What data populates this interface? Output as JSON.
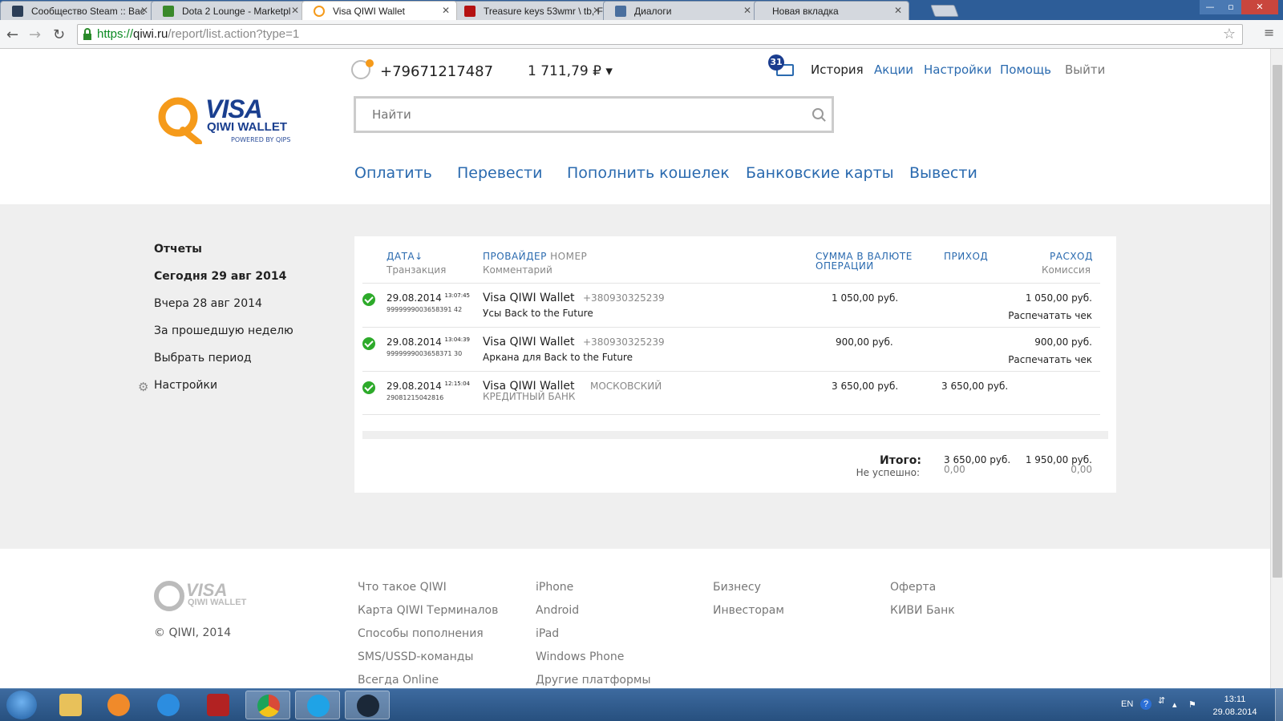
{
  "browser": {
    "tabs": [
      {
        "title": "Сообщество Steam :: Вас",
        "active": false,
        "fav_color": "#2c3e57"
      },
      {
        "title": "Dota 2 Lounge - Marketpl",
        "active": false,
        "fav_color": "#3b8a2b"
      },
      {
        "title": "Visa QIWI Wallet",
        "active": true,
        "fav_color": "#f59a1a"
      },
      {
        "title": "Treasure keys 53wmr \\ tb, F",
        "active": false,
        "fav_color": "#b51212"
      },
      {
        "title": "Диалоги",
        "active": false,
        "fav_color": "#4a6f9e"
      },
      {
        "title": "Новая вкладка",
        "active": false,
        "fav_color": ""
      }
    ],
    "url_scheme": "https://",
    "url_domain": "qiwi.ru",
    "url_path": "/report/list.action?type=1",
    "window_buttons": {
      "minimize": "—",
      "maximize": "▫",
      "close": "✕"
    }
  },
  "header": {
    "logo": {
      "visa": "VISA",
      "wallet": "QIWI WALLET",
      "powered": "POWERED BY QIPS"
    },
    "phone": "+79671217487",
    "balance": "1 711,79 ₽ ▾",
    "mail_count": "31",
    "top_nav": [
      {
        "label": "История",
        "active": true
      },
      {
        "label": "Акции",
        "active": false
      },
      {
        "label": "Настройки",
        "active": false
      },
      {
        "label": "Помощь",
        "active": false
      },
      {
        "label": "Выйти",
        "active": false
      }
    ],
    "search_placeholder": "Найти",
    "main_nav": [
      "Оплатить",
      "Перевести",
      "Пополнить кошелек",
      "Банковские карты",
      "Вывести"
    ]
  },
  "sidebar": {
    "items": [
      "Отчеты",
      "Сегодня 29 авг 2014",
      "Вчера 28 авг 2014",
      "За прошедшую неделю",
      "Выбрать период",
      "Настройки"
    ]
  },
  "table": {
    "headers": {
      "date": "ДАТА",
      "date_sort": "↓",
      "date_sub": "Транзакция",
      "provider": "ПРОВАЙДЕР",
      "number": "НОМЕР",
      "provider_sub": "Комментарий",
      "amount_l1": "СУММА В ВАЛЮТЕ",
      "amount_l2": "ОПЕРАЦИИ",
      "income": "ПРИХОД",
      "expense": "РАСХОД",
      "expense_sub": "Комиссия"
    },
    "rows": [
      {
        "date": "29.08.2014",
        "time": "13:07:45",
        "txn": "9999999003658391 42",
        "provider": "Visa QIWI Wallet",
        "number": "+380930325239",
        "comment": "Усы Back to the Future",
        "amount": "1 050,00 руб.",
        "income": "",
        "expense": "1 050,00 руб.",
        "action": "Распечатать чек"
      },
      {
        "date": "29.08.2014",
        "time": "13:04:39",
        "txn": "9999999003658371 30",
        "provider": "Visa QIWI Wallet",
        "number": "+380930325239",
        "comment": "Аркана для Back to the Future",
        "amount": "900,00 руб.",
        "income": "",
        "expense": "900,00 руб.",
        "action": "Распечатать чек"
      },
      {
        "date": "29.08.2014",
        "time": "12:15:04",
        "txn": "29081215042816",
        "provider": "Visa QIWI Wallet",
        "number": "МОСКОВСКИЙ",
        "comment": "КРЕДИТНЫЙ БАНК",
        "amount": "3 650,00 руб.",
        "income": "3 650,00 руб.",
        "expense": "",
        "action": ""
      }
    ],
    "totals": {
      "label": "Итого:",
      "failed_label": "Не успешно:",
      "income": "3 650,00 руб.",
      "income_failed": "0,00",
      "expense": "1 950,00 руб.",
      "expense_failed": "0,00"
    }
  },
  "footer": {
    "logo": {
      "visa": "VISA",
      "wallet": "QIWI WALLET"
    },
    "copyright": "© QIWI, 2014",
    "col1": [
      "Что такое QIWI",
      "Карта QIWI Терминалов",
      "Способы пополнения",
      "SMS/USSD-команды",
      "Всегда Online"
    ],
    "col2": [
      "iPhone",
      "Android",
      "iPad",
      "Windows Phone",
      "Другие платформы"
    ],
    "col3": [
      "Бизнесу",
      "Инвесторам"
    ],
    "col4": [
      "Оферта",
      "КИВИ Банк"
    ]
  },
  "taskbar": {
    "apps": [
      "Проводник",
      "Media Player",
      "Internet Explorer",
      "Dota 2",
      "Google Chrome",
      "Skype",
      "Steam"
    ],
    "lang": "EN",
    "time": "13:11",
    "date": "29.08.2014"
  },
  "colors": {
    "link": "#2a6aaf",
    "brand_orange": "#f59a1a",
    "brand_blue": "#1a3f8f",
    "ok_green": "#2daa2a",
    "body_bg": "#efefef"
  }
}
